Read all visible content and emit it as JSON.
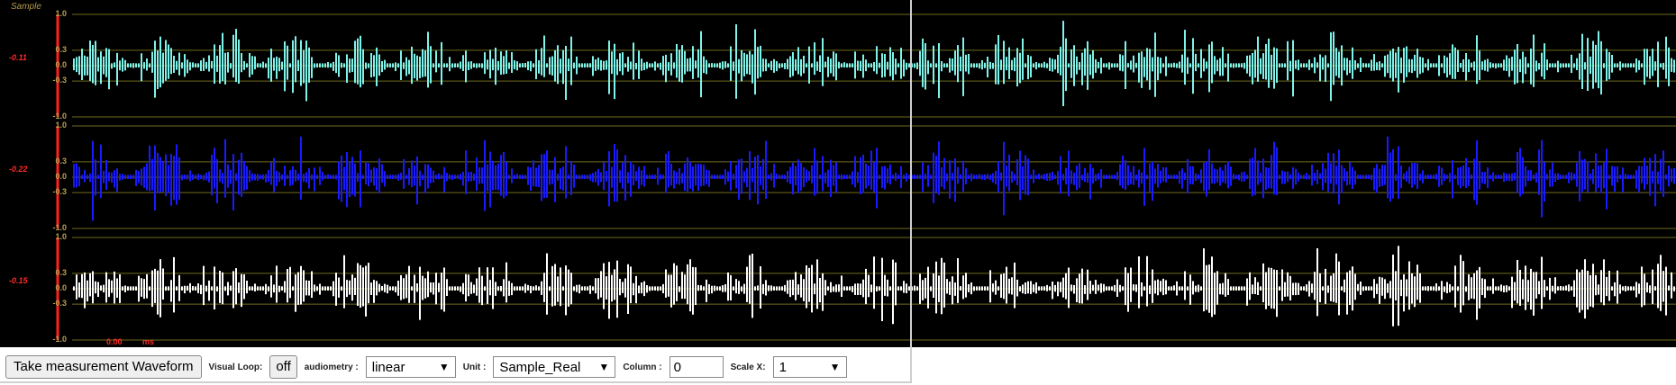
{
  "viewer": {
    "sample_label": "Sample",
    "y_ticks": [
      "1.0",
      "0.3",
      "0.0",
      "-0.3",
      "-1.0"
    ],
    "time_value": "0.00",
    "time_unit": "ms",
    "channels": [
      {
        "name": "channel-1",
        "value_label": "-0.11",
        "color": "#7ff3ea"
      },
      {
        "name": "channel-2",
        "value_label": "-0.22",
        "color": "#1a1aff"
      },
      {
        "name": "channel-3",
        "value_label": "-0.15",
        "color": "#ffffff"
      }
    ],
    "colors": {
      "grid": "#6f6a1e",
      "cursor": "#ff2020",
      "axis_text": "#b8a050"
    }
  },
  "toolbar": {
    "take_measurement_label": "Take measurement Waveform",
    "visual_loop_label": "Visual Loop:",
    "visual_loop_value": "off",
    "audiometry_label": "audiometry :",
    "audiometry_value": "linear",
    "unit_label": "Unit :",
    "unit_value": "Sample_Real",
    "column_label": "Column :",
    "column_value": "0",
    "scale_x_label": "Scale X:",
    "scale_x_value": "1"
  }
}
